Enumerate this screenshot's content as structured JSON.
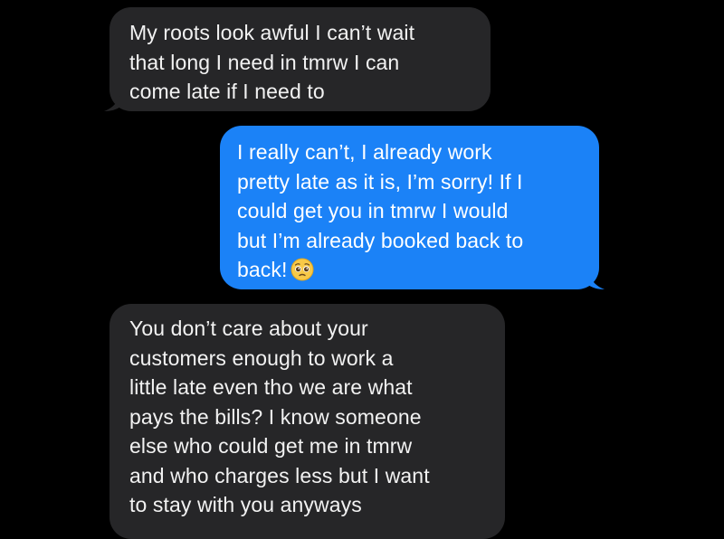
{
  "conversation": {
    "messages": [
      {
        "direction": "incoming",
        "lines": [
          "My roots look awful I can’t wait",
          "that long I need in tmrw I can",
          "come late if I need to"
        ]
      },
      {
        "direction": "outgoing",
        "lines": [
          "I really can’t, I already work",
          "pretty late as it is, I’m sorry! If I",
          "could get you in tmrw I would",
          "but I’m already booked back to",
          "back!"
        ],
        "emoji": "pleading-face-emoji"
      },
      {
        "direction": "incoming",
        "lines": [
          "You don’t care about your",
          "customers enough to work a",
          "little late even tho we are what",
          "pays the bills? I know someone",
          "else who could get me in tmrw",
          "and who charges less but I want",
          "to stay with you anyways"
        ]
      }
    ]
  },
  "colors": {
    "background": "#000000",
    "incoming_bubble": "#262628",
    "outgoing_bubble": "#1b82f7",
    "incoming_text": "#f2f2f2",
    "outgoing_text": "#ffffff"
  }
}
